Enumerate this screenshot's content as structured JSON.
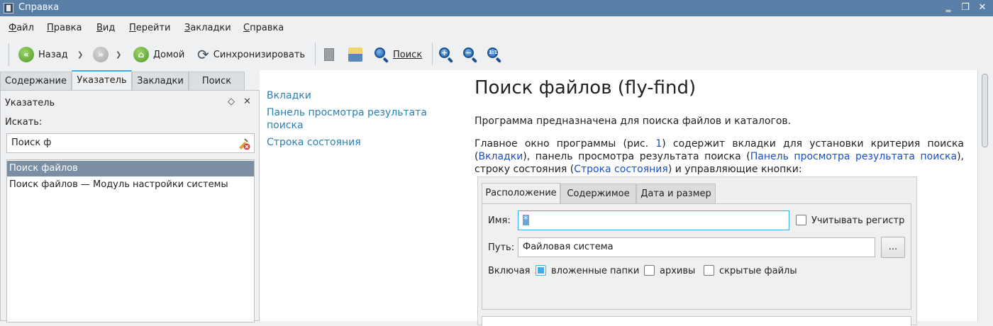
{
  "window": {
    "title": "Справка"
  },
  "menu": [
    {
      "accel": "Ф",
      "rest": "айл"
    },
    {
      "accel": "П",
      "rest": "равка"
    },
    {
      "accel": "В",
      "rest": "ид"
    },
    {
      "accel": "П",
      "rest": "ерейти"
    },
    {
      "accel": "З",
      "rest": "акладки"
    },
    {
      "accel": "С",
      "rest": "правка"
    }
  ],
  "toolbar": {
    "back_label": "Назад",
    "home_label": "Домой",
    "sync_label": "Синхронизировать",
    "search_label": "Поиск"
  },
  "left_tabs": [
    "Содержание",
    "Указатель",
    "Закладки",
    "Поиск"
  ],
  "index_panel": {
    "title": "Указатель",
    "search_label": "Искать:",
    "search_value": "Поиск ф",
    "results": [
      "Поиск файлов",
      "Поиск файлов — Модуль настройки системы"
    ]
  },
  "toc": [
    "Вкладки",
    "Панель просмотра результата поиска",
    "Строка состояния"
  ],
  "doc": {
    "title": "Поиск файлов (fly-find)",
    "intro": "Программа предназначена для поиска файлов и каталогов.",
    "p2": {
      "t1": "Главное окно программы (рис. ",
      "fig_ref": "1",
      "t2": ") содержит вкладки для установки критерия поиска (",
      "link1": "Вкладки",
      "t3": "), панель просмотра результата поиска (",
      "link2": "Панель просмотра результата поиска",
      "t4": "), строку состояния (",
      "link3": "Строка состояния",
      "t5": ") и управляющие кнопки:"
    }
  },
  "figure": {
    "tabs": [
      "Расположение",
      "Содержимое",
      "Дата и размер"
    ],
    "name_label": "Имя:",
    "name_value": "*",
    "case_label": "Учитывать регистр",
    "path_label": "Путь:",
    "path_value": "Файловая система",
    "browse_label": "...",
    "include_label": "Включая",
    "options": [
      "вложенные папки",
      "архивы",
      "скрытые файлы"
    ]
  }
}
